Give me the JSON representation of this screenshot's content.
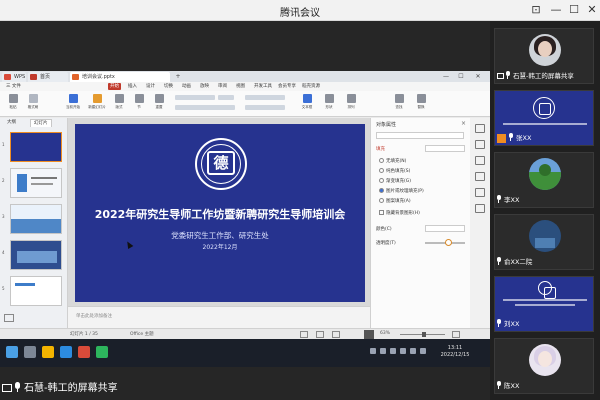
{
  "window": {
    "title": "腾讯会议",
    "minimize": "—",
    "maximize": "☐",
    "close": "✕"
  },
  "browser": {
    "tabs": [
      {
        "label": "WPS",
        "color": "#d94b3a"
      },
      {
        "label": "首页",
        "color": "#c0392b"
      },
      {
        "label": "培训会议.pptx",
        "color": "#e0632a"
      }
    ],
    "new_tab": "+"
  },
  "ribbon": {
    "menu": [
      "三 文件",
      "开始",
      "插入",
      "设计",
      "切换",
      "动画",
      "放映",
      "审阅",
      "视图",
      "开发工具",
      "会员专享",
      "稻壳资源"
    ],
    "active_index": 1,
    "tools": [
      {
        "label": "粘贴",
        "color": "#8a8f99"
      },
      {
        "label": "格式刷",
        "color": "#b0b6c1"
      },
      {
        "label": "当前开始",
        "color": "#3b6fd6"
      },
      {
        "label": "新建幻灯片",
        "color": "#e59b2f"
      },
      {
        "label": "版式",
        "color": "#8a8f99"
      },
      {
        "label": "节",
        "color": "#8a8f99"
      },
      {
        "label": "重置",
        "color": "#8a8f99"
      },
      {
        "label": "文本框",
        "color": "#3b6fd6"
      },
      {
        "label": "形状",
        "color": "#8a8f99"
      },
      {
        "label": "排列",
        "color": "#8a8f99"
      },
      {
        "label": "查找",
        "color": "#8a8f99"
      },
      {
        "label": "替换",
        "color": "#8a8f99"
      }
    ]
  },
  "slides_panel": {
    "tabs": [
      "大纲",
      "幻灯片"
    ],
    "numbers": [
      "1",
      "2",
      "3",
      "4",
      "5"
    ]
  },
  "slide": {
    "logo_glyph": "德",
    "title": "2022年研究生导师工作坊暨新聘研究生导师培训会",
    "subtitle": "党委研究生工作部、研究生处",
    "date": "2022年12月",
    "bg_color": "#26338f"
  },
  "notes_placeholder": "单击此处添加备注",
  "property_pane": {
    "title": "对象属性",
    "close": "×",
    "section": "填充",
    "options": [
      "无填充(N)",
      "纯色填充(S)",
      "渐变填充(G)",
      "图片或纹理填充(P)",
      "图案填充(A)",
      "隐藏背景图形(H)"
    ],
    "row_color": "颜色(C)",
    "row_transparency": "透明度(T)"
  },
  "statusbar": {
    "slide_info": "幻灯片 1 / 35",
    "theme": "Office 主题",
    "zoom": "63%"
  },
  "taskbar": {
    "time": "13:11",
    "date": "2022/12/15"
  },
  "sharer_label": "石慧-韩工的屏幕共享",
  "participants": [
    {
      "name": "石慧-韩工的屏幕共享",
      "type": "avatar-girl",
      "screen": true
    },
    {
      "name": "张XX",
      "type": "logo"
    },
    {
      "name": "李XX",
      "type": "tree"
    },
    {
      "name": "俞XX二院",
      "type": "dark"
    },
    {
      "name": "刘XX",
      "type": "slide"
    },
    {
      "name": "陈XX",
      "type": "avatar-anime"
    }
  ],
  "colors": {
    "accent_red": "#c0392b",
    "slide_blue": "#26338f",
    "selection_orange": "#f08d21"
  }
}
